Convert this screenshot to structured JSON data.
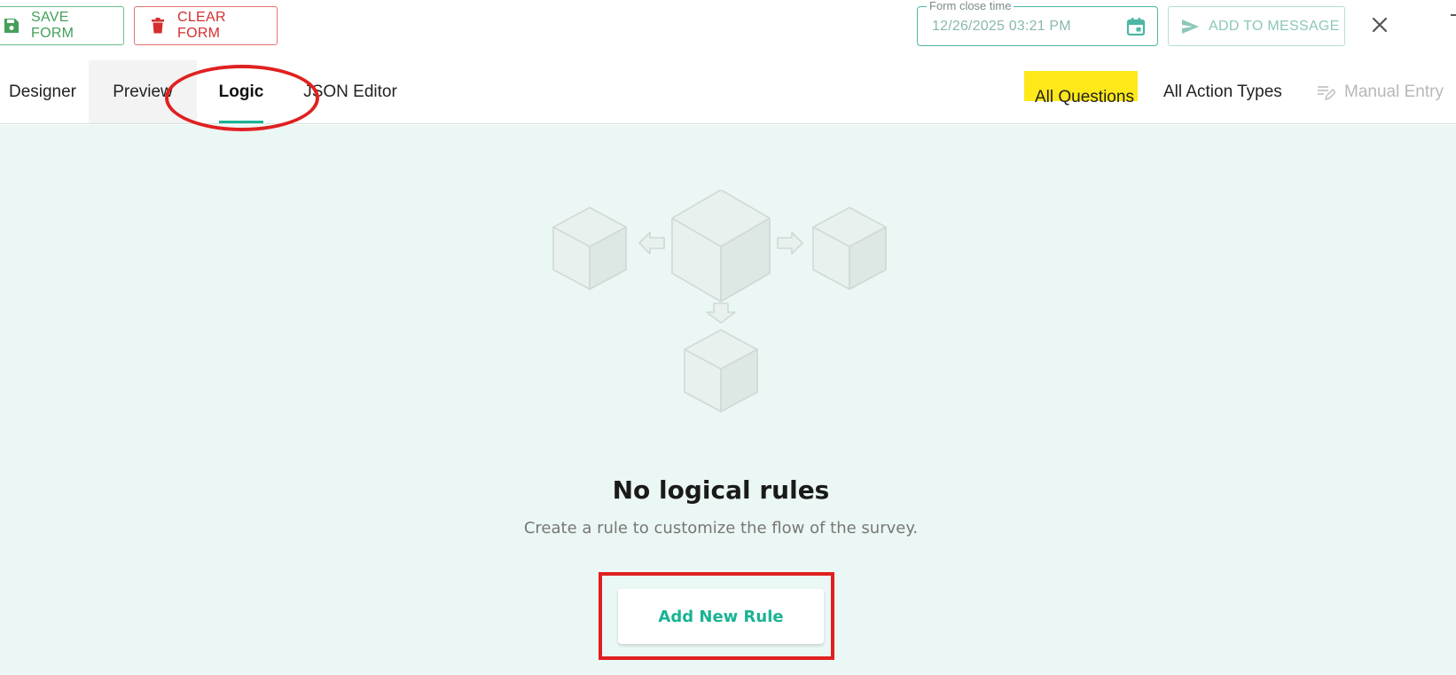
{
  "toolbar": {
    "save_label": "SAVE FORM",
    "clear_label": "CLEAR FORM",
    "date_field": {
      "label": "Form close time",
      "value": "12/26/2025 03:21 PM"
    },
    "add_to_message_label": "ADD TO MESSAGE"
  },
  "tabs": [
    {
      "label": "Designer",
      "active": false
    },
    {
      "label": "Preview",
      "active": false
    },
    {
      "label": "Logic",
      "active": true
    },
    {
      "label": "JSON Editor",
      "active": false
    }
  ],
  "filters": {
    "questions_label": "All Questions",
    "actions_label": "All Action Types",
    "manual_entry_label": "Manual Entry"
  },
  "empty_state": {
    "title": "No logical rules",
    "subtitle": "Create a rule to customize the flow of the survey.",
    "button_label": "Add New Rule"
  },
  "colors": {
    "accent": "#19b394",
    "save_green": "#43a05a",
    "clear_red": "#d32f2f",
    "canvas_bg": "#ebf7f4",
    "highlight_yellow": "#ffe81a",
    "annotation_red": "#e02020"
  },
  "icons": {
    "save": "floppy-disk-icon",
    "clear": "trash-icon",
    "calendar": "calendar-icon",
    "send": "send-icon",
    "close": "close-icon",
    "manual_entry": "edit-list-icon"
  }
}
